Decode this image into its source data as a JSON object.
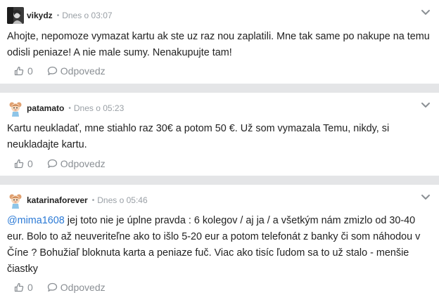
{
  "comments": [
    {
      "author": "vikydz",
      "separator": "•",
      "time": "Dnes o 03:07",
      "text": "Ahojte, nepomoze vymazat kartu ak ste uz raz nou zaplatili. Mne tak same po nakupe na temu odisli peniaze! A nie male sumy. Nenakupujte tam!",
      "likes": "0",
      "reply_label": "Odpovedz",
      "avatar_icon": "user-photo-avatar"
    },
    {
      "author": "patamato",
      "separator": "•",
      "time": "Dnes o 05:23",
      "text": "Kartu neukladať, mne stiahlo raz 30€ a potom 50 €. Už som vymazala Temu, nikdy, si neukladajte kartu.",
      "likes": "0",
      "reply_label": "Odpovedz",
      "avatar_icon": "cartoon-girl-avatar"
    },
    {
      "author": "katarinaforever",
      "separator": "•",
      "time": "Dnes o 05:46",
      "mention": "@mima1608",
      "text": " jej toto nie je úplne pravda : 6 kolegov / aj ja / a všetkým nám zmizlo od 30-40 eur. Bolo to až neuveriteľne ako to išlo 5-20 eur a potom telefonát z banky či som náhodou v Číne ? Bohužiaľ bloknuta karta a peniaze fuč. Viac ako tisíc ľudom sa to už stalo - menšie čiastky",
      "likes": "0",
      "reply_label": "Odpovedz",
      "avatar_icon": "cartoon-girl-avatar"
    }
  ],
  "colors": {
    "mention": "#2b7ad6",
    "muted": "#9aa0a6",
    "background": "#e4e5e7"
  }
}
